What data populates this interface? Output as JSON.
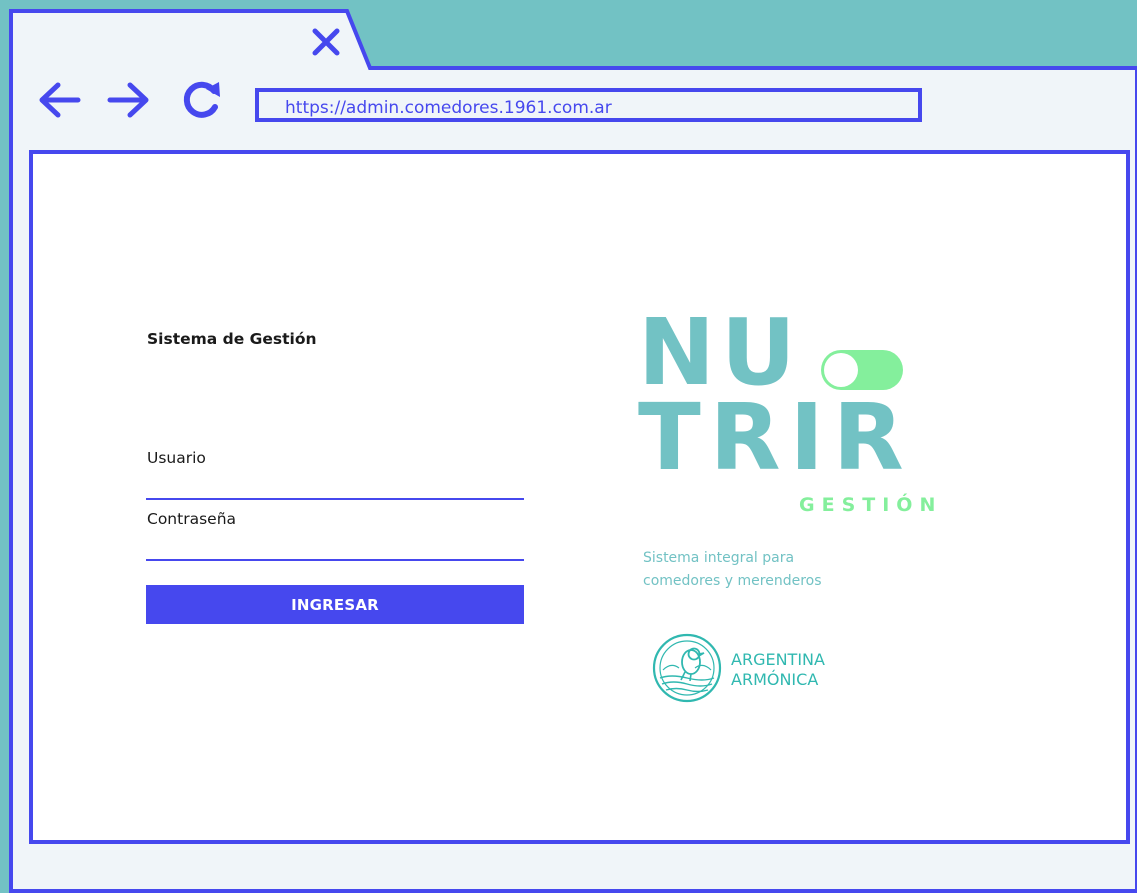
{
  "browser": {
    "url": "https://admin.comedores.1961.com.ar"
  },
  "login": {
    "title": "Sistema de Gestión",
    "username_label": "Usuario",
    "username_value": "",
    "password_label": "Contraseña",
    "password_value": "",
    "submit_label": "INGRESAR"
  },
  "brand": {
    "logo_line1": "NU",
    "logo_line2": "TRIR",
    "logo_sub": "GESTIÓN",
    "tagline_line1": "Sistema integral para",
    "tagline_line2": "comedores y merenderos",
    "partner_line1": "ARGENTINA",
    "partner_line2": "ARMÓNICA"
  },
  "icons": {
    "tab_close": "close-icon",
    "back": "arrow-left-icon",
    "forward": "arrow-right-icon",
    "reload": "reload-icon",
    "logo_toggle": "toggle-switch-icon",
    "partner_logo": "argentina-armonica-logo-icon"
  },
  "colors": {
    "accent_blue": "#4648ee",
    "brand_teal": "#72c2c4",
    "brand_green": "#84ef9c",
    "partner_teal": "#30b8b0",
    "chrome_background": "#f0f5f9"
  }
}
